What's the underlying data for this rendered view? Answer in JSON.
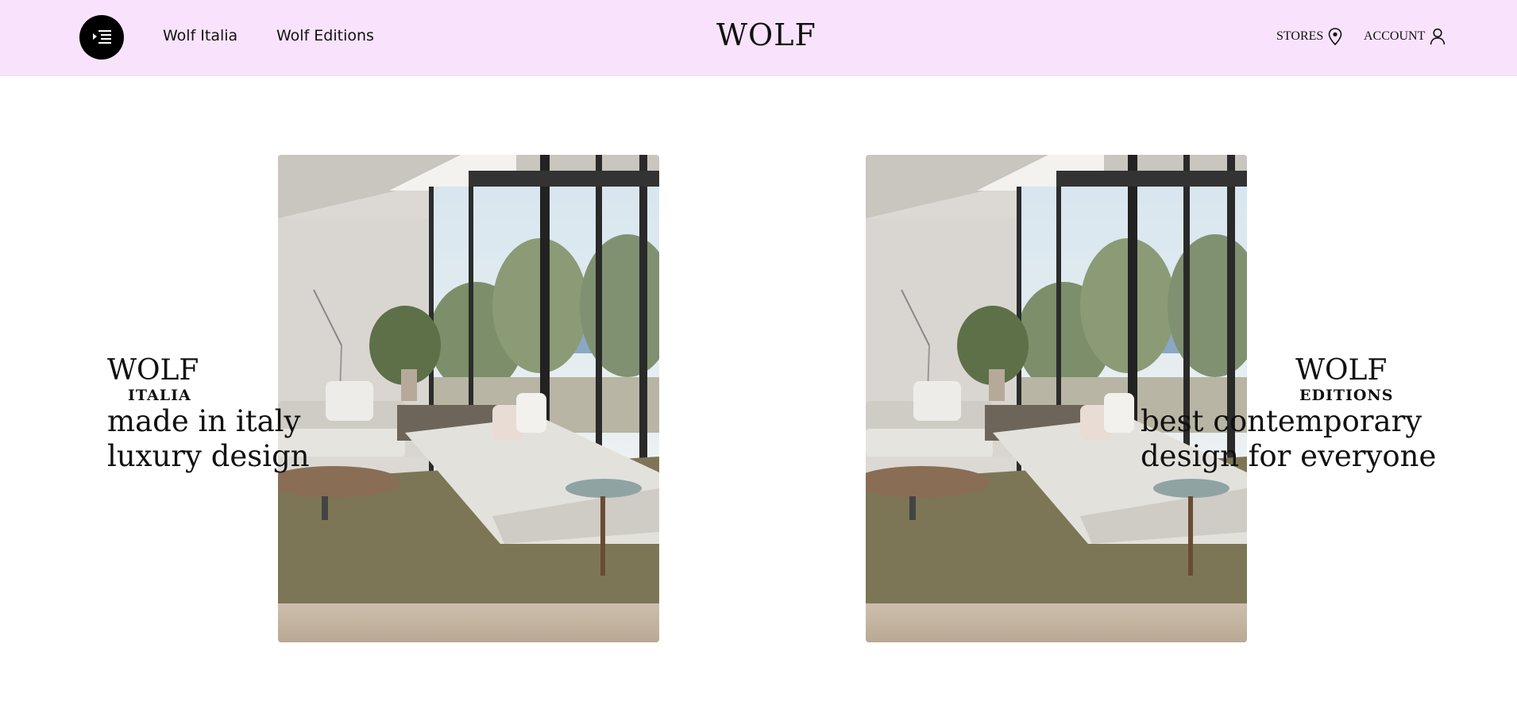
{
  "header": {
    "nav": [
      "Wolf Italia",
      "Wolf Editions"
    ],
    "logo": "WOLF",
    "stores_label": "STORES",
    "account_label": "ACCOUNT",
    "background": "#f9e3fc"
  },
  "cards": [
    {
      "title": "WOLF",
      "subtitle": "ITALIA",
      "tagline": [
        "made in italy",
        "luxury design"
      ]
    },
    {
      "title": "WOLF",
      "subtitle": "EDITIONS",
      "tagline": [
        "best contemporary",
        "design for everyone"
      ]
    }
  ],
  "icons": {
    "menu": "menu-indent-icon",
    "stores": "location-pin-icon",
    "account": "user-icon"
  }
}
